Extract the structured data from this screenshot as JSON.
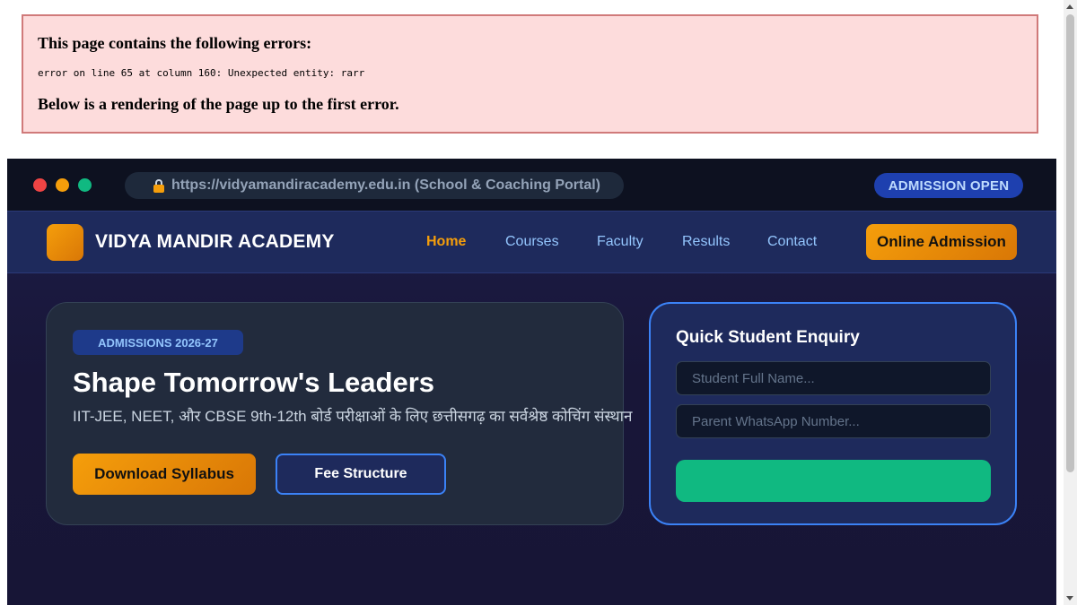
{
  "xml_error": {
    "heading": "This page contains the following errors:",
    "detail": "error on line 65 at column 160: Unexpected entity: rarr",
    "footer": "Below is a rendering of the page up to the first error."
  },
  "browser": {
    "url": "https://vidyamandiracademy.edu.in (School & Coaching Portal)",
    "badge": "ADMISSION OPEN"
  },
  "navbar": {
    "brand": "VIDYA MANDIR ACADEMY",
    "links": [
      {
        "label": "Home",
        "active": true
      },
      {
        "label": "Courses"
      },
      {
        "label": "Faculty"
      },
      {
        "label": "Results"
      },
      {
        "label": "Contact"
      }
    ],
    "cta": "Online Admission"
  },
  "hero": {
    "badge": "ADMISSIONS 2026-27",
    "title": "Shape Tomorrow's Leaders",
    "subtitle": "IIT-JEE, NEET, और CBSE 9th-12th बोर्ड परीक्षाओं के लिए छत्तीसगढ़ का सर्वश्रेष्ठ कोचिंग संस्थान",
    "primary_button": "Download Syllabus",
    "secondary_button": "Fee Structure"
  },
  "enquiry": {
    "title": "Quick Student Enquiry",
    "name_placeholder": "Student Full Name...",
    "phone_placeholder": "Parent WhatsApp Number...",
    "submit_label": ""
  },
  "colors": {
    "accent_orange": "#f59e0b",
    "accent_blue": "#3b82f6",
    "accent_green": "#10b981",
    "navy": "#1e2a5c"
  },
  "icons": [
    "lock-icon",
    "window-close-dot-icon",
    "window-minimize-dot-icon",
    "window-maximize-dot-icon"
  ]
}
